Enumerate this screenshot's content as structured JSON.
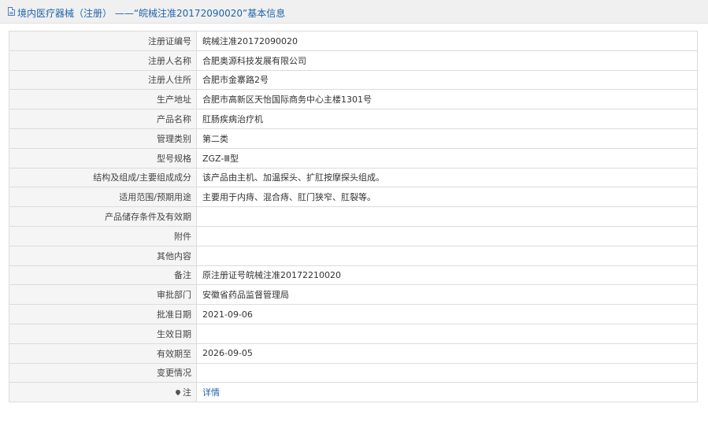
{
  "header": {
    "icon": "document-icon",
    "title": "境内医疗器械（注册） ——“皖械注准20172090020”基本信息"
  },
  "rows": [
    {
      "label": "注册证编号",
      "value": "皖械注准20172090020"
    },
    {
      "label": "注册人名称",
      "value": "合肥奥源科技发展有限公司"
    },
    {
      "label": "注册人住所",
      "value": "合肥市金寨路2号"
    },
    {
      "label": "生产地址",
      "value": "合肥市高新区天怡国际商务中心主楼1301号"
    },
    {
      "label": "产品名称",
      "value": "肛肠疾病治疗机"
    },
    {
      "label": "管理类别",
      "value": "第二类"
    },
    {
      "label": "型号规格",
      "value": "ZGZ-Ⅲ型"
    },
    {
      "label": "结构及组成/主要组成成分",
      "value": "该产品由主机、加温探头、扩肛按摩探头组成。"
    },
    {
      "label": "适用范围/预期用途",
      "value": "主要用于内痔、混合痔、肛门狭窄、肛裂等。"
    },
    {
      "label": "产品储存条件及有效期",
      "value": ""
    },
    {
      "label": "附件",
      "value": ""
    },
    {
      "label": "其他内容",
      "value": ""
    },
    {
      "label": "备注",
      "value": "原注册证号皖械注准20172210020"
    },
    {
      "label": "审批部门",
      "value": "安徽省药品监督管理局"
    },
    {
      "label": "批准日期",
      "value": "2021-09-06"
    },
    {
      "label": "生效日期",
      "value": ""
    },
    {
      "label": "有效期至",
      "value": "2026-09-05"
    },
    {
      "label": "变更情况",
      "value": ""
    }
  ],
  "note_row": {
    "icon": "pin-icon",
    "label": "注",
    "link": "详情"
  },
  "colors": {
    "accent": "#1f63ac",
    "label_bg": "#f5f5f5",
    "border": "#dcdcdc"
  }
}
